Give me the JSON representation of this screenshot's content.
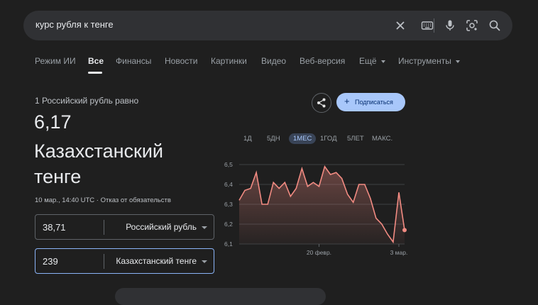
{
  "search": {
    "query": "курс рубля к тенге"
  },
  "tabs": [
    {
      "label": "Режим ИИ"
    },
    {
      "label": "Все"
    },
    {
      "label": "Финансы"
    },
    {
      "label": "Новости"
    },
    {
      "label": "Картинки"
    },
    {
      "label": "Видео"
    },
    {
      "label": "Веб-версия"
    },
    {
      "label": "Ещё"
    },
    {
      "label": "Инструменты"
    }
  ],
  "converter": {
    "equals_text": "1 Российский рубль равно",
    "amount": "6,17",
    "currency_name": "Казахстанский тенге",
    "timestamp": "10 мар., 14:40 UTC · Отказ от обязательств",
    "from": {
      "value": "38,71",
      "currency": "Российский рубль"
    },
    "to": {
      "value": "239",
      "currency": "Казахстанский тенге"
    }
  },
  "actions": {
    "subscribe_label": "Подписаться"
  },
  "ranges": [
    {
      "label": "1Д"
    },
    {
      "label": "5ДН"
    },
    {
      "label": "1МЕС"
    },
    {
      "label": "1ГОД"
    },
    {
      "label": "5ЛЕТ"
    },
    {
      "label": "МАКС."
    }
  ],
  "chart_data": {
    "type": "area",
    "ylim": [
      6.1,
      6.5
    ],
    "y_ticks": [
      6.5,
      6.4,
      6.3,
      6.2,
      6.1
    ],
    "y_tick_labels": [
      "6,5",
      "6,4",
      "6,3",
      "6,2",
      "6,1"
    ],
    "x_ticks": [
      {
        "label": "20 февр.",
        "index": 14
      },
      {
        "label": "3 мар.",
        "index": 28
      }
    ],
    "values": [
      6.32,
      6.37,
      6.38,
      6.46,
      6.3,
      6.3,
      6.41,
      6.38,
      6.41,
      6.34,
      6.38,
      6.48,
      6.39,
      6.41,
      6.39,
      6.49,
      6.45,
      6.46,
      6.43,
      6.35,
      6.31,
      6.4,
      6.4,
      6.33,
      6.23,
      6.2,
      6.15,
      6.11,
      6.36,
      6.17
    ],
    "line_color": "#f28b82"
  }
}
